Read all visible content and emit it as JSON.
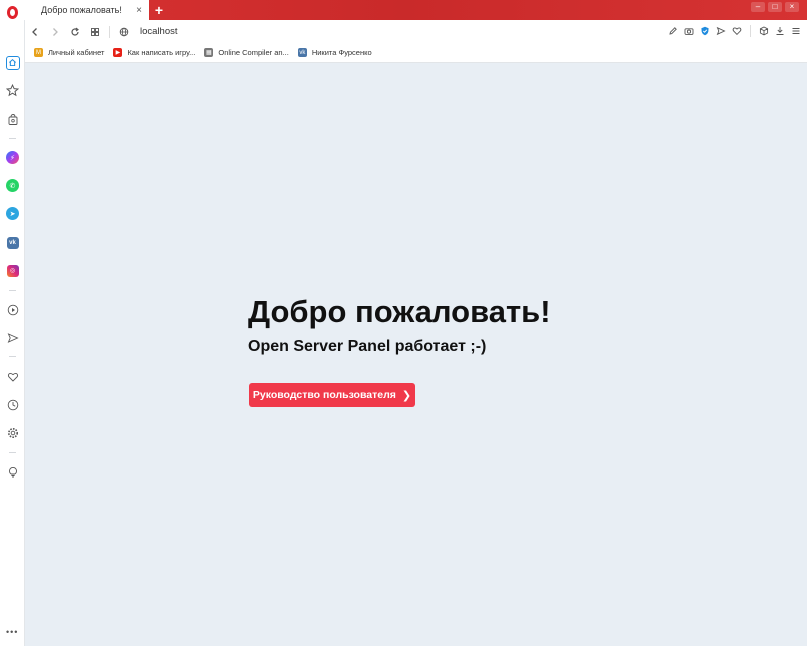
{
  "browser": {
    "tab": {
      "title": "Добро пожаловать!",
      "close_glyph": "×"
    },
    "new_tab_glyph": "+",
    "window_controls": {
      "minimize": "–",
      "maximize": "□",
      "close": "×"
    },
    "address": {
      "url": "localhost"
    },
    "nav": {
      "back": "back-icon",
      "forward": "forward-icon",
      "reload": "reload-icon",
      "tabs": "grid-icon",
      "site": "globe-icon"
    },
    "toolbar_icons": [
      "edit-icon",
      "camera-icon",
      "vpn-shield-icon",
      "send-icon",
      "heart-icon",
      "box-icon",
      "download-icon",
      "menu-icon"
    ],
    "colors": {
      "tabstrip": "#d32f2f",
      "accent": "#1f8bde",
      "button": "#f0394a"
    }
  },
  "bookmarks": [
    {
      "label": "Личный кабинет",
      "icon": "mts-icon",
      "color": "#e7a21b"
    },
    {
      "label": "Как написать игру...",
      "icon": "youtube-icon",
      "color": "#e62117"
    },
    {
      "label": "Online Compiler an...",
      "icon": "compiler-icon",
      "color": "#777777"
    },
    {
      "label": "Никита Фурсенко",
      "icon": "vk-icon",
      "color": "#4a76a8"
    }
  ],
  "sidebar": {
    "items": [
      {
        "name": "home-icon"
      },
      {
        "name": "star-icon"
      },
      {
        "name": "bag-icon"
      },
      {
        "name": "messenger-icon",
        "color": "#2a7cf7"
      },
      {
        "name": "whatsapp-icon",
        "color": "#25d366"
      },
      {
        "name": "telegram-icon",
        "color": "#2ca5e0"
      },
      {
        "name": "vk-icon",
        "color": "#4a76a8"
      },
      {
        "name": "instagram-icon",
        "color": "#d62976"
      },
      {
        "name": "player-icon"
      },
      {
        "name": "send-icon"
      },
      {
        "name": "heart-icon"
      },
      {
        "name": "history-icon"
      },
      {
        "name": "settings-icon"
      },
      {
        "name": "bulb-icon"
      }
    ],
    "more_glyph": "•••"
  },
  "page": {
    "title": "Добро пожаловать!",
    "subtitle": "Open Server Panel работает ;-)",
    "button_label": "Руководство пользователя",
    "button_chevron": "❯"
  }
}
